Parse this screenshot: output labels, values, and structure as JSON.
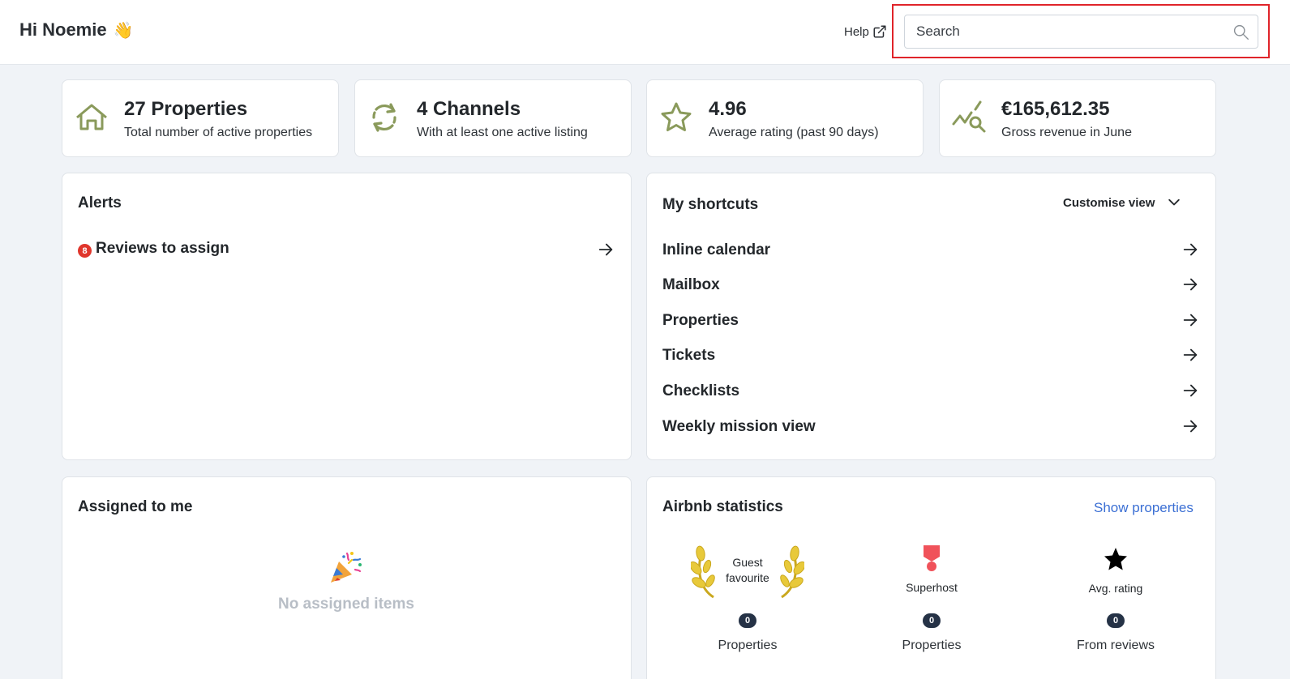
{
  "header": {
    "greeting": "Hi Noemie",
    "greeting_emoji": "👋",
    "help_label": "Help",
    "search_placeholder": "Search"
  },
  "stats": [
    {
      "value": "27 Properties",
      "desc": "Total number of active properties",
      "icon": "home-icon"
    },
    {
      "value": "4 Channels",
      "desc": "With at least one active listing",
      "icon": "sync-icon"
    },
    {
      "value": "4.96",
      "desc": "Average rating (past 90 days)",
      "icon": "star-outline-icon"
    },
    {
      "value": "€165,612.35",
      "desc": "Gross revenue in June",
      "icon": "revenue-chart-icon"
    }
  ],
  "alerts": {
    "title": "Alerts",
    "items": [
      {
        "count": "8",
        "label": "Reviews to assign"
      }
    ]
  },
  "shortcuts": {
    "title": "My shortcuts",
    "customise_label": "Customise view",
    "items": [
      {
        "label": "Inline calendar"
      },
      {
        "label": "Mailbox"
      },
      {
        "label": "Properties"
      },
      {
        "label": "Tickets"
      },
      {
        "label": "Checklists"
      },
      {
        "label": "Weekly mission view"
      }
    ]
  },
  "assigned": {
    "title": "Assigned to me",
    "empty_text": "No assigned items",
    "empty_icon": "party-popper-icon"
  },
  "airbnb": {
    "title": "Airbnb statistics",
    "link_label": "Show properties",
    "columns": [
      {
        "name_line1": "Guest",
        "name_line2": "favourite",
        "count": "0",
        "label": "Properties",
        "icon": "laurel-icon"
      },
      {
        "name": "Superhost",
        "count": "0",
        "label": "Properties",
        "icon": "superhost-icon"
      },
      {
        "name": "Avg. rating",
        "count": "0",
        "label": "From reviews",
        "icon": "star-icon"
      }
    ]
  },
  "colors": {
    "accent_olive": "#8a9a5b",
    "badge_red": "#e0362c",
    "link_blue": "#3b6fd4",
    "count_navy": "#253246",
    "highlight_red": "#e0242a"
  }
}
